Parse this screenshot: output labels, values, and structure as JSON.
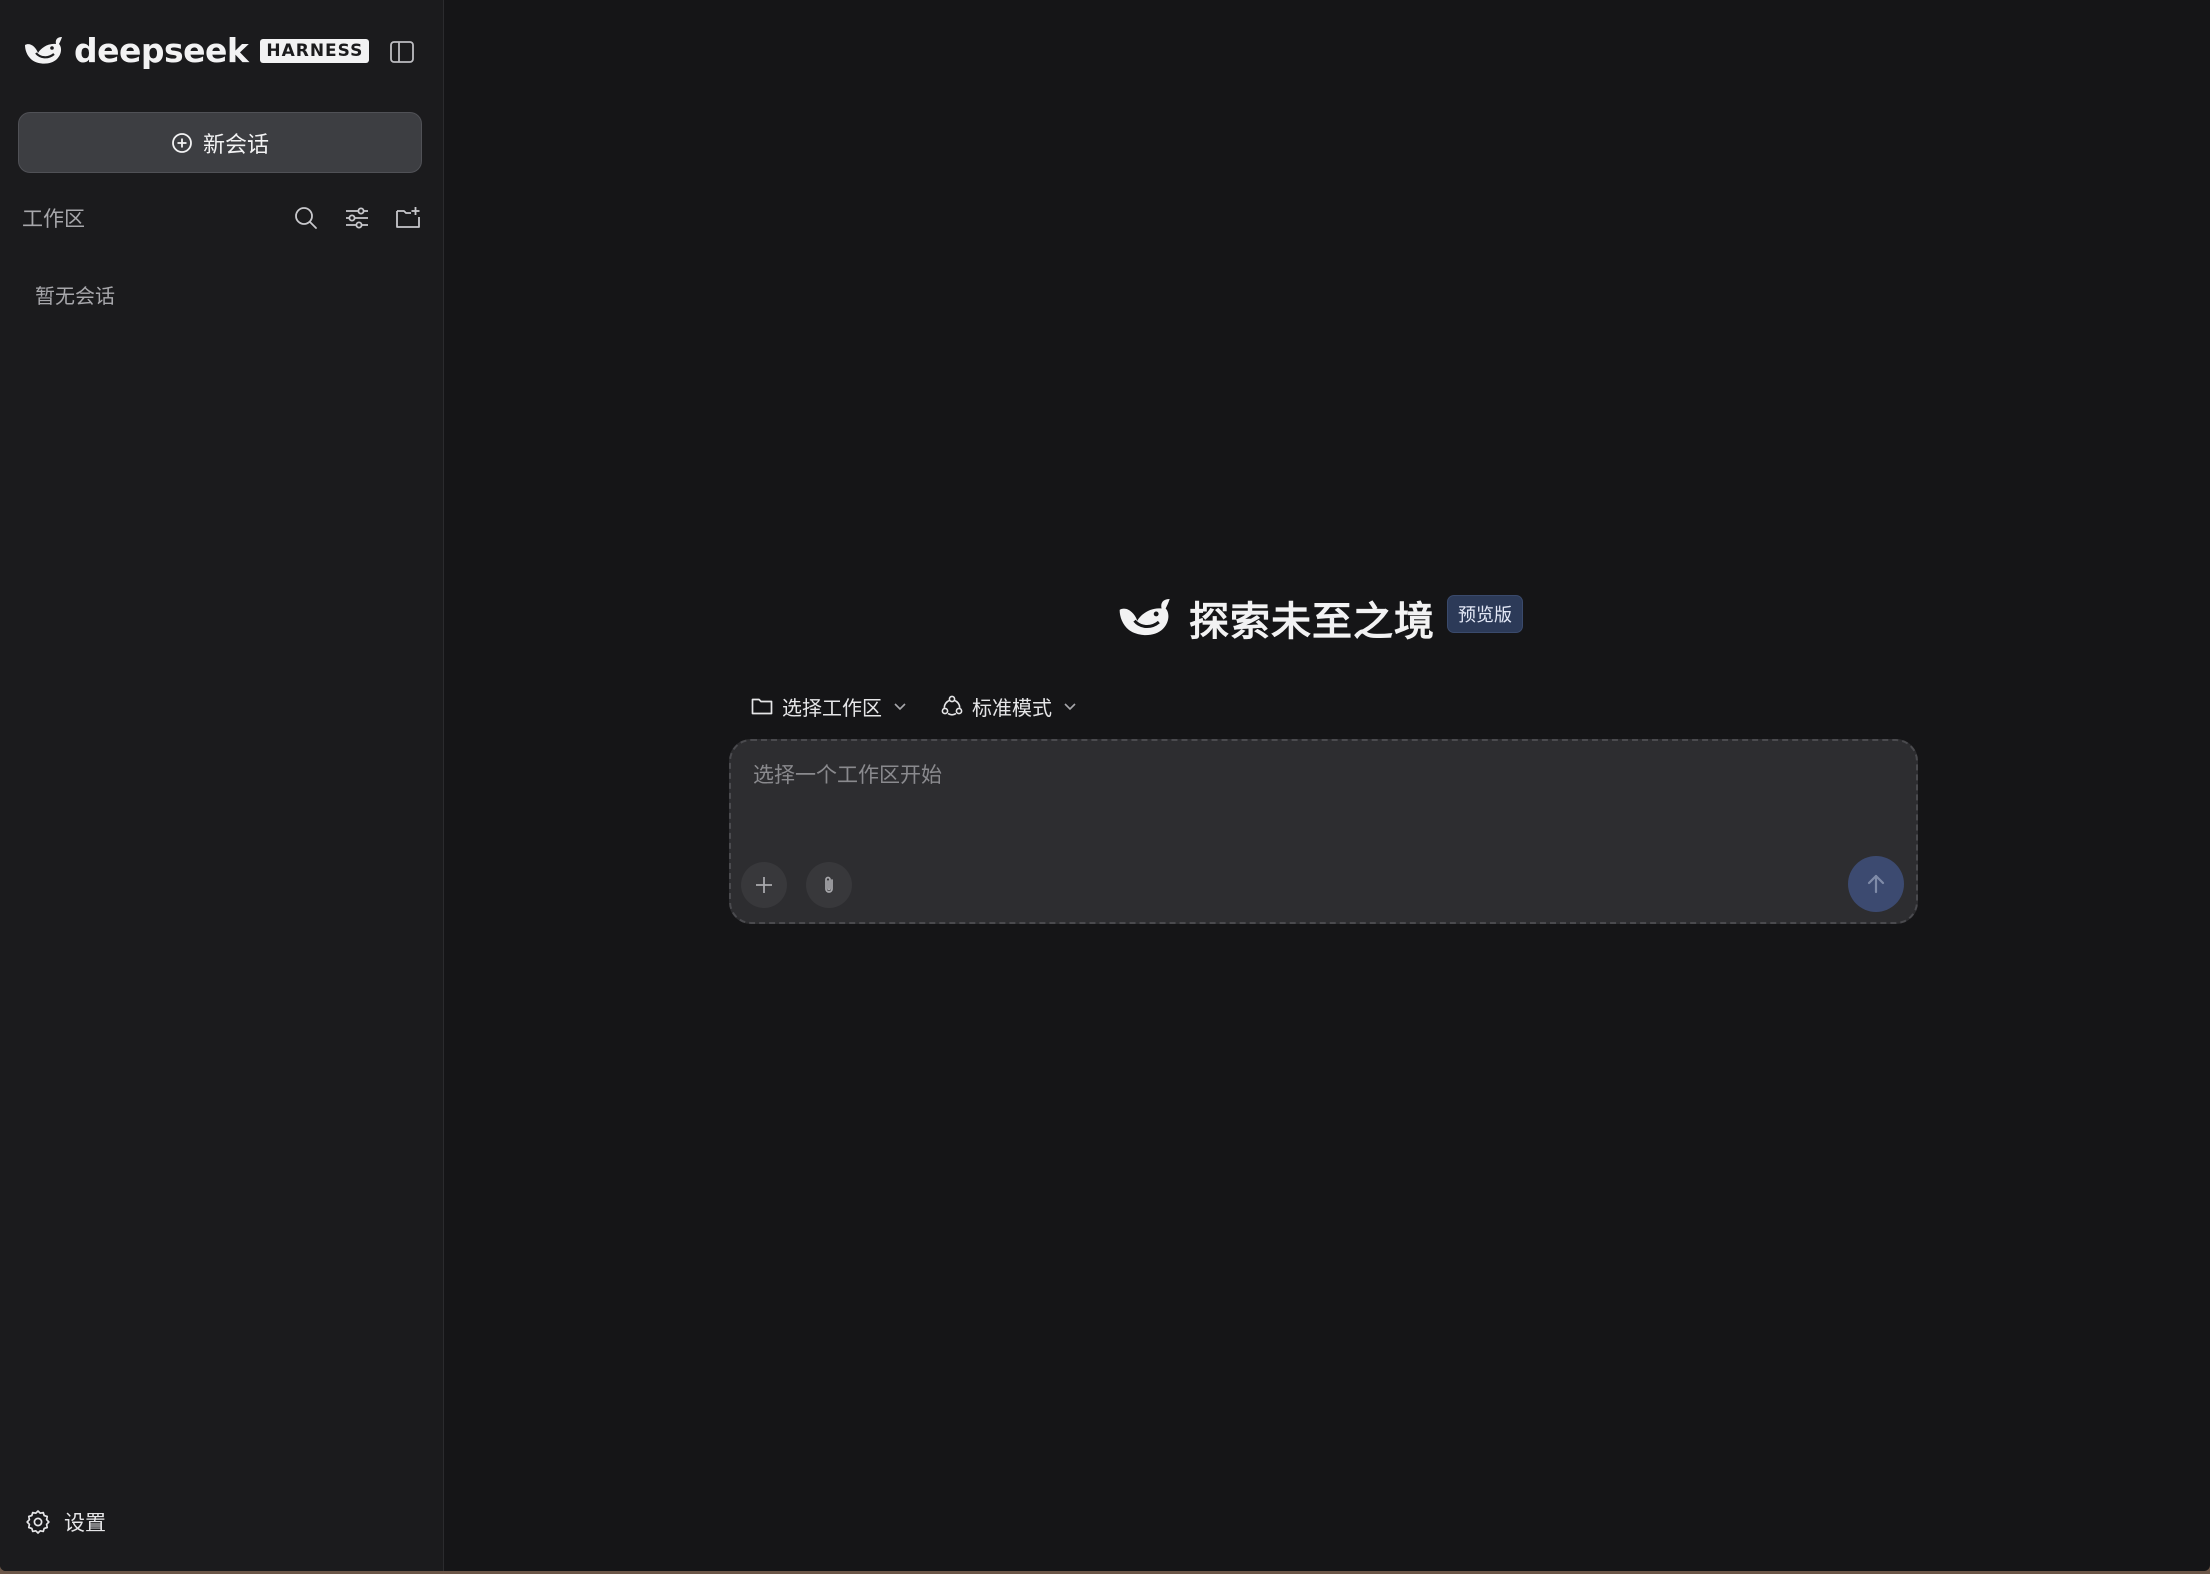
{
  "sidebar": {
    "brand": {
      "name": "deepseek",
      "tag": "HARNESS"
    },
    "new_chat_label": "新会话",
    "workspace": {
      "title": "工作区",
      "icons": [
        "search-icon",
        "filter-sliders-icon",
        "new-folder-icon"
      ]
    },
    "empty_text": "暂无会话",
    "settings_label": "设置"
  },
  "main": {
    "hero": {
      "title": "探索未至之境",
      "badge": "预览版"
    },
    "controls": {
      "workspace_select": "选择工作区",
      "mode_select": "标准模式"
    },
    "composer": {
      "placeholder": "选择一个工作区开始",
      "value": ""
    }
  },
  "colors": {
    "app_background": "#151517",
    "sidebar_background": "#1b1b1d",
    "composer_background": "#2d2d30",
    "badge_background": "#2c3a58",
    "send_button": "#3c4a70"
  }
}
